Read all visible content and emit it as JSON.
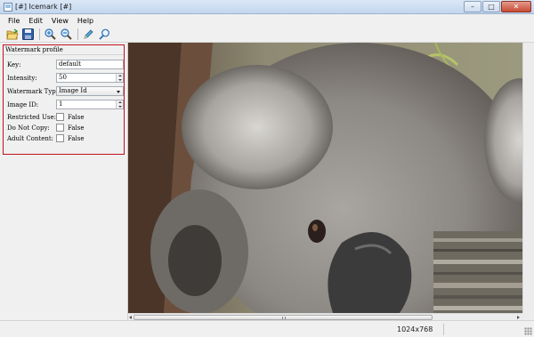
{
  "window": {
    "title": "[#] Icemark [#]",
    "controls": [
      "–",
      "□",
      "✕"
    ]
  },
  "menu": {
    "items": [
      "File",
      "Edit",
      "View",
      "Help"
    ]
  },
  "toolbar": {
    "buttons": [
      {
        "icon": "open-folder-icon"
      },
      {
        "icon": "save-disk-icon"
      },
      {
        "icon": "zoom-in-icon"
      },
      {
        "icon": "zoom-out-icon"
      },
      {
        "icon": "pencil-icon"
      },
      {
        "icon": "search-icon"
      }
    ]
  },
  "profile": {
    "title": "Watermark profile",
    "key_label": "Key:",
    "key_value": "default",
    "intensity_label": "Intensity:",
    "intensity_value": "50",
    "watermark_type_label": "Watermark Type:",
    "watermark_type_value": "Image Id",
    "image_id_label": "Image ID:",
    "image_id_value": "1",
    "restricted_label": "Restricted Use:",
    "restricted_value": "False",
    "do_not_copy_label": "Do Not Copy:",
    "do_not_copy_value": "False",
    "adult_label": "Adult Content:",
    "adult_value": "False"
  },
  "image": {
    "subject": "koala photo"
  },
  "status": {
    "resolution": "1024x768"
  },
  "colors": {
    "highlight_border": "#c0121d",
    "panel_bg": "#f0f0f0"
  }
}
